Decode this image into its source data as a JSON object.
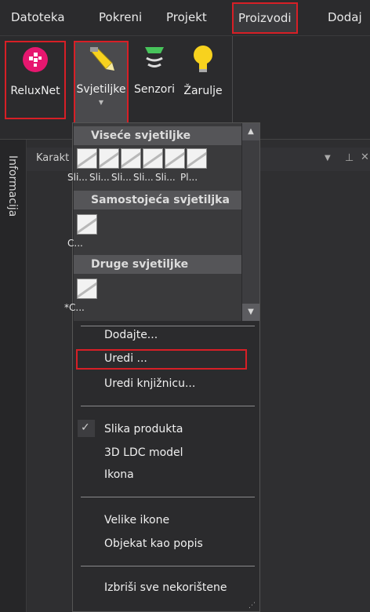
{
  "menubar": {
    "items": [
      "Datoteka",
      "Pokreni",
      "Projekt",
      "Proizvodi",
      "Dodaj"
    ]
  },
  "ribbon": {
    "relux_label": "ReluxNet",
    "svjetiljke_label": "Svjetiljke",
    "senzori_label": "Senzori",
    "zarulje_label": "Žarulje"
  },
  "side": {
    "info_tab": "Informacija",
    "panel_title": "Karakt"
  },
  "dropdown": {
    "categories": [
      "Viseće svjetiljke",
      "Samostojeća svjetiljka",
      "Druge svjetiljke"
    ],
    "row1_labels": [
      "Sli...",
      "Sli...",
      "Sli...",
      "Sli...",
      "Sli...",
      "Pl..."
    ],
    "row2_label": "C...",
    "row3_label": "*C...",
    "items": {
      "add": "Dodajte...",
      "edit": "Uredi ...",
      "edit_library": "Uredi knjižnicu...",
      "product_image": "Slika produkta",
      "ldc_model": "3D LDC model",
      "icon": "Ikona",
      "large_icons": "Velike ikone",
      "list_view": "Objekat kao popis",
      "delete_unused": "Izbriši sve nekorištene"
    }
  },
  "colors": {
    "highlight": "#d71f26",
    "relux_brand": "#e6176f",
    "bulb": "#f7d21e",
    "sensor": "#47c45b"
  }
}
